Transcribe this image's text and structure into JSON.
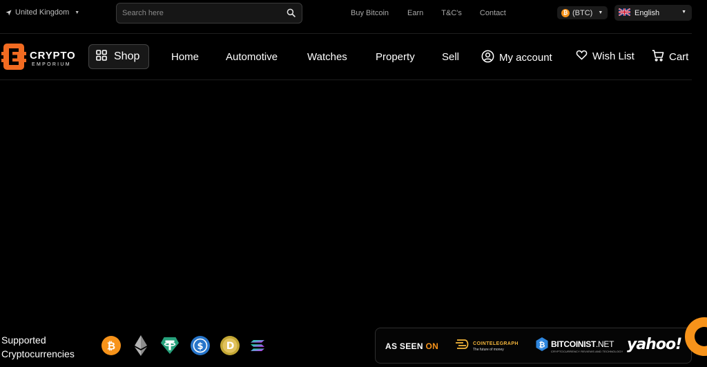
{
  "topbar": {
    "country": "United Kingdom",
    "search_placeholder": "Search here",
    "links": [
      "Buy Bitcoin",
      "Earn",
      "T&C's",
      "Contact"
    ],
    "currency": "(BTC)",
    "language": "English"
  },
  "logo": {
    "title": "CRYPTO",
    "subtitle": "EMPORIUM"
  },
  "nav": {
    "shop": "Shop",
    "items": [
      "Home",
      "Automotive",
      "Watches",
      "Property",
      "Sell"
    ],
    "my_account": "My account",
    "wish_list": "Wish List",
    "cart": "Cart"
  },
  "footer": {
    "supported_line1": "Supported",
    "supported_line2": "Cryptocurrencies",
    "coin_icons": [
      "bitcoin-icon",
      "ethereum-icon",
      "tether-icon",
      "usd-coin-icon",
      "dogecoin-icon",
      "solana-icon"
    ],
    "as_seen": "AS SEEN",
    "as_seen_on": "ON",
    "cointelegraph_title": "COINTELEGRAPH",
    "cointelegraph_sub": "The future of money",
    "bitcoinist_title": "BITCOINIST",
    "bitcoinist_dot": ".NET",
    "bitcoinist_sub": "CRYPTOCURRENCY REVIEWS AND TECHNOLOGY",
    "yahoo": "yahoo!"
  },
  "colors": {
    "background": "#000000",
    "accent": "#f7931a",
    "logo_orange": "#f26b21"
  }
}
